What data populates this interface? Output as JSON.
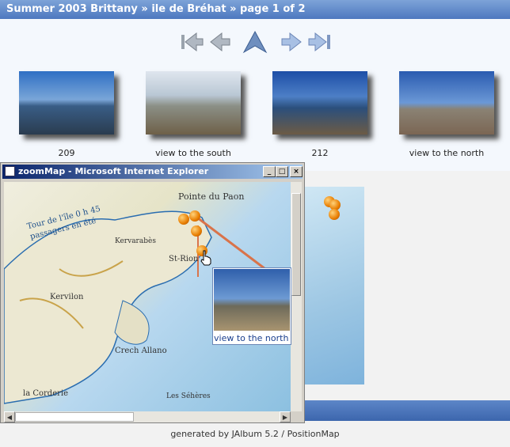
{
  "header": {
    "title": "Summer 2003 Brittany » ile de Bréhat » page 1 of 2"
  },
  "nav": [
    {
      "name": "first-page-icon"
    },
    {
      "name": "previous-page-icon"
    },
    {
      "name": "up-icon"
    },
    {
      "name": "next-page-icon"
    },
    {
      "name": "last-page-icon"
    }
  ],
  "thumbnails": [
    {
      "caption": "209"
    },
    {
      "caption": "view to the south"
    },
    {
      "caption": "212"
    },
    {
      "caption": "view to the north"
    }
  ],
  "window": {
    "title": "zoomMap - Microsoft Internet Explorer",
    "controls": {
      "minimize": "_",
      "maximize": "□",
      "close": "×"
    }
  },
  "map": {
    "labels": {
      "pointe": "Pointe du Paon",
      "tour1": "Tour de l'île 0 h 45",
      "tour2": "passagers en été",
      "kervarabes": "Kervarabès",
      "strion": "St-Rion",
      "kervilon": "Kervilon",
      "crech": "Crech Allano",
      "corderie": "la Corderie",
      "sehres": "Les Séhères"
    },
    "popup": {
      "caption": "view to the north"
    }
  },
  "colors": {
    "header": "#4d78bf",
    "accent": "#e87d00"
  },
  "footer": {
    "text": "generated by JAlbum 5.2 / PositionMap"
  }
}
